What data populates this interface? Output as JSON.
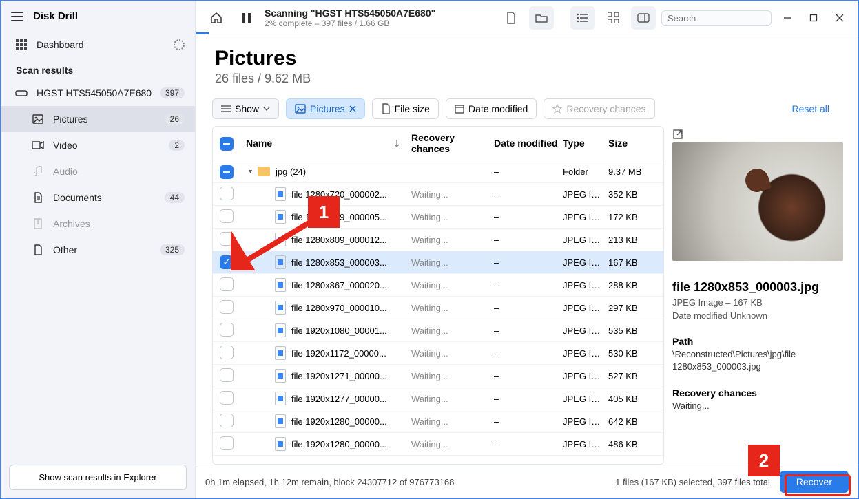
{
  "app_title": "Disk Drill",
  "sidebar": {
    "dashboard": "Dashboard",
    "section": "Scan results",
    "drive": {
      "label": "HGST HTS545050A7E680",
      "badge": "397"
    },
    "items": [
      {
        "label": "Pictures",
        "badge": "26",
        "active": true
      },
      {
        "label": "Video",
        "badge": "2"
      },
      {
        "label": "Audio",
        "muted": true
      },
      {
        "label": "Documents",
        "badge": "44"
      },
      {
        "label": "Archives",
        "muted": true
      },
      {
        "label": "Other",
        "badge": "325"
      }
    ],
    "footer_button": "Show scan results in Explorer"
  },
  "topbar": {
    "title": "Scanning \"HGST HTS545050A7E680\"",
    "subtitle": "2% complete – 397 files / 1.66 GB",
    "search_placeholder": "Search"
  },
  "heading": {
    "title": "Pictures",
    "sub": "26 files / 9.62 MB"
  },
  "filters": {
    "show": "Show",
    "pictures": "Pictures",
    "filesize": "File size",
    "datemod": "Date modified",
    "recovery": "Recovery chances",
    "reset": "Reset all"
  },
  "columns": {
    "name": "Name",
    "recovery": "Recovery chances",
    "date": "Date modified",
    "type": "Type",
    "size": "Size"
  },
  "group": {
    "label": "jpg (24)",
    "date": "–",
    "type": "Folder",
    "size": "9.37 MB"
  },
  "rows": [
    {
      "name": "file 1280x720_000002...",
      "rec": "Waiting...",
      "date": "–",
      "type": "JPEG Im...",
      "size": "352 KB"
    },
    {
      "name": "file 1280x749_000005...",
      "rec": "Waiting...",
      "date": "–",
      "type": "JPEG Im...",
      "size": "172 KB"
    },
    {
      "name": "file 1280x809_000012...",
      "rec": "Waiting...",
      "date": "–",
      "type": "JPEG Im...",
      "size": "213 KB"
    },
    {
      "name": "file 1280x853_000003...",
      "rec": "Waiting...",
      "date": "–",
      "type": "JPEG Im...",
      "size": "167 KB",
      "selected": true
    },
    {
      "name": "file 1280x867_000020...",
      "rec": "Waiting...",
      "date": "–",
      "type": "JPEG Im...",
      "size": "288 KB"
    },
    {
      "name": "file 1280x970_000010...",
      "rec": "Waiting...",
      "date": "–",
      "type": "JPEG Im...",
      "size": "297 KB"
    },
    {
      "name": "file 1920x1080_00001...",
      "rec": "Waiting...",
      "date": "–",
      "type": "JPEG Im...",
      "size": "535 KB"
    },
    {
      "name": "file 1920x1172_00000...",
      "rec": "Waiting...",
      "date": "–",
      "type": "JPEG Im...",
      "size": "530 KB"
    },
    {
      "name": "file 1920x1271_00000...",
      "rec": "Waiting...",
      "date": "–",
      "type": "JPEG Im...",
      "size": "527 KB"
    },
    {
      "name": "file 1920x1277_00000...",
      "rec": "Waiting...",
      "date": "–",
      "type": "JPEG Im...",
      "size": "405 KB"
    },
    {
      "name": "file 1920x1280_00000...",
      "rec": "Waiting...",
      "date": "–",
      "type": "JPEG Im...",
      "size": "642 KB"
    },
    {
      "name": "file 1920x1280_00000...",
      "rec": "Waiting...",
      "date": "–",
      "type": "JPEG Im...",
      "size": "486 KB"
    }
  ],
  "preview": {
    "filename": "file 1280x853_000003.jpg",
    "meta": "JPEG Image – 167 KB",
    "datemod": "Date modified Unknown",
    "path_h": "Path",
    "path": "\\Reconstructed\\Pictures\\jpg\\file 1280x853_000003.jpg",
    "rec_h": "Recovery chances",
    "rec": "Waiting..."
  },
  "status": {
    "left": "0h 1m elapsed, 1h 12m remain, block 24307712 of 976773168",
    "right": "1 files (167 KB) selected, 397 files total",
    "recover": "Recover"
  },
  "annotations": {
    "one": "1",
    "two": "2"
  }
}
